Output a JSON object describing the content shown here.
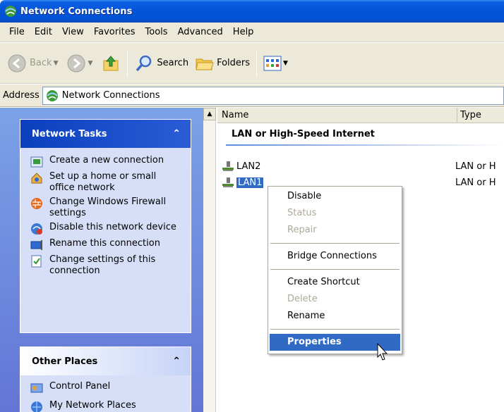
{
  "window": {
    "title": "Network Connections"
  },
  "menubar": [
    "File",
    "Edit",
    "View",
    "Favorites",
    "Tools",
    "Advanced",
    "Help"
  ],
  "toolbar": {
    "back": "Back",
    "search": "Search",
    "folders": "Folders"
  },
  "address": {
    "label": "Address",
    "value": "Network Connections"
  },
  "network_tasks": {
    "title": "Network Tasks",
    "items": [
      {
        "label": "Create a new connection",
        "icon": "new-connection-icon"
      },
      {
        "label": "Set up a home or small office network",
        "icon": "home-network-icon"
      },
      {
        "label": "Change Windows Firewall settings",
        "icon": "firewall-icon"
      },
      {
        "label": "Disable this network device",
        "icon": "disable-device-icon"
      },
      {
        "label": "Rename this connection",
        "icon": "rename-icon"
      },
      {
        "label": "Change settings of this connection",
        "icon": "settings-icon"
      }
    ]
  },
  "other_places": {
    "title": "Other Places",
    "items": [
      {
        "label": "Control Panel",
        "icon": "control-panel-icon"
      },
      {
        "label": "My Network Places",
        "icon": "network-places-icon"
      }
    ]
  },
  "list": {
    "columns": [
      "Name",
      "Type"
    ],
    "group": "LAN or High-Speed Internet",
    "rows": [
      {
        "name": "LAN2",
        "type": "LAN or H"
      },
      {
        "name": "LAN1",
        "type": "LAN or H",
        "selected": true
      }
    ]
  },
  "context_menu": {
    "items": [
      {
        "label": "Disable",
        "enabled": true
      },
      {
        "label": "Status",
        "enabled": false
      },
      {
        "label": "Repair",
        "enabled": false
      },
      {
        "label": "Bridge Connections",
        "enabled": true
      },
      {
        "label": "Create Shortcut",
        "enabled": true
      },
      {
        "label": "Delete",
        "enabled": false
      },
      {
        "label": "Rename",
        "enabled": true
      },
      {
        "label": "Properties",
        "enabled": true,
        "default": true,
        "highlighted": true
      }
    ]
  },
  "colors": {
    "title_blue": "#0553d6",
    "selection": "#316ac5",
    "taskpane": "#7ba2e7"
  }
}
